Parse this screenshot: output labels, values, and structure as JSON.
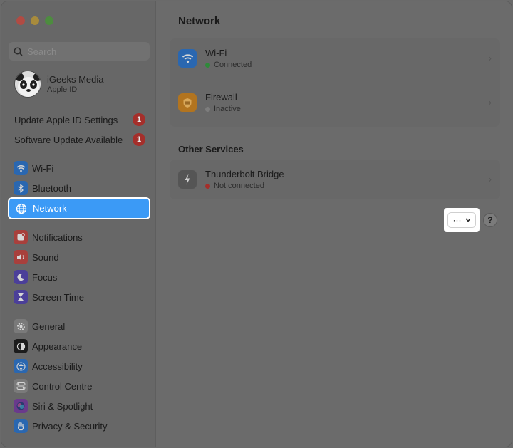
{
  "window": {
    "traffic_lights": [
      "close",
      "minimize",
      "zoom"
    ]
  },
  "search": {
    "placeholder": "Search"
  },
  "account": {
    "name": "iGeeks Media",
    "subtitle": "Apple ID"
  },
  "notices": [
    {
      "label": "Update Apple ID Settings",
      "badge": "1"
    },
    {
      "label": "Software Update Available",
      "badge": "1"
    }
  ],
  "sidebar": {
    "items": [
      {
        "label": "Wi-Fi",
        "icon": "wifi-icon",
        "color": "#2a67b0"
      },
      {
        "label": "Bluetooth",
        "icon": "bluetooth-icon",
        "color": "#2a67b0"
      },
      {
        "label": "Network",
        "icon": "globe-icon",
        "color": "#3b9af6",
        "selected": true
      },
      {
        "label": "Notifications",
        "icon": "bell-icon",
        "color": "#a8403c"
      },
      {
        "label": "Sound",
        "icon": "speaker-icon",
        "color": "#a8403c"
      },
      {
        "label": "Focus",
        "icon": "moon-icon",
        "color": "#4b3f99"
      },
      {
        "label": "Screen Time",
        "icon": "hourglass-icon",
        "color": "#4b3f99"
      },
      {
        "label": "General",
        "icon": "gear-icon",
        "color": "#7a7a7a"
      },
      {
        "label": "Appearance",
        "icon": "appearance-icon",
        "color": "#1c1c1c"
      },
      {
        "label": "Accessibility",
        "icon": "accessibility-icon",
        "color": "#2a67b0"
      },
      {
        "label": "Control Centre",
        "icon": "control-centre-icon",
        "color": "#7a7a7a"
      },
      {
        "label": "Siri & Spotlight",
        "icon": "siri-icon",
        "color": "#6a3a8c"
      },
      {
        "label": "Privacy & Security",
        "icon": "hand-icon",
        "color": "#2a67b0"
      }
    ]
  },
  "main": {
    "title": "Network",
    "services": [
      {
        "name": "Wi-Fi",
        "status": "Connected",
        "status_color": "#2f8a3a",
        "icon": "wifi-icon",
        "icon_color": "#2a67b0"
      },
      {
        "name": "Firewall",
        "status": "Inactive",
        "status_color": "#7d7d7d",
        "icon": "firewall-icon",
        "icon_color": "#b2741f"
      }
    ],
    "other_title": "Other Services",
    "other_services": [
      {
        "name": "Thunderbolt Bridge",
        "status": "Not connected",
        "status_color": "#a52f2b",
        "icon": "thunderbolt-icon",
        "icon_color": "#555555"
      }
    ],
    "more_button": {
      "label": "···",
      "chevron": "⌄"
    },
    "help_button": {
      "label": "?"
    }
  }
}
